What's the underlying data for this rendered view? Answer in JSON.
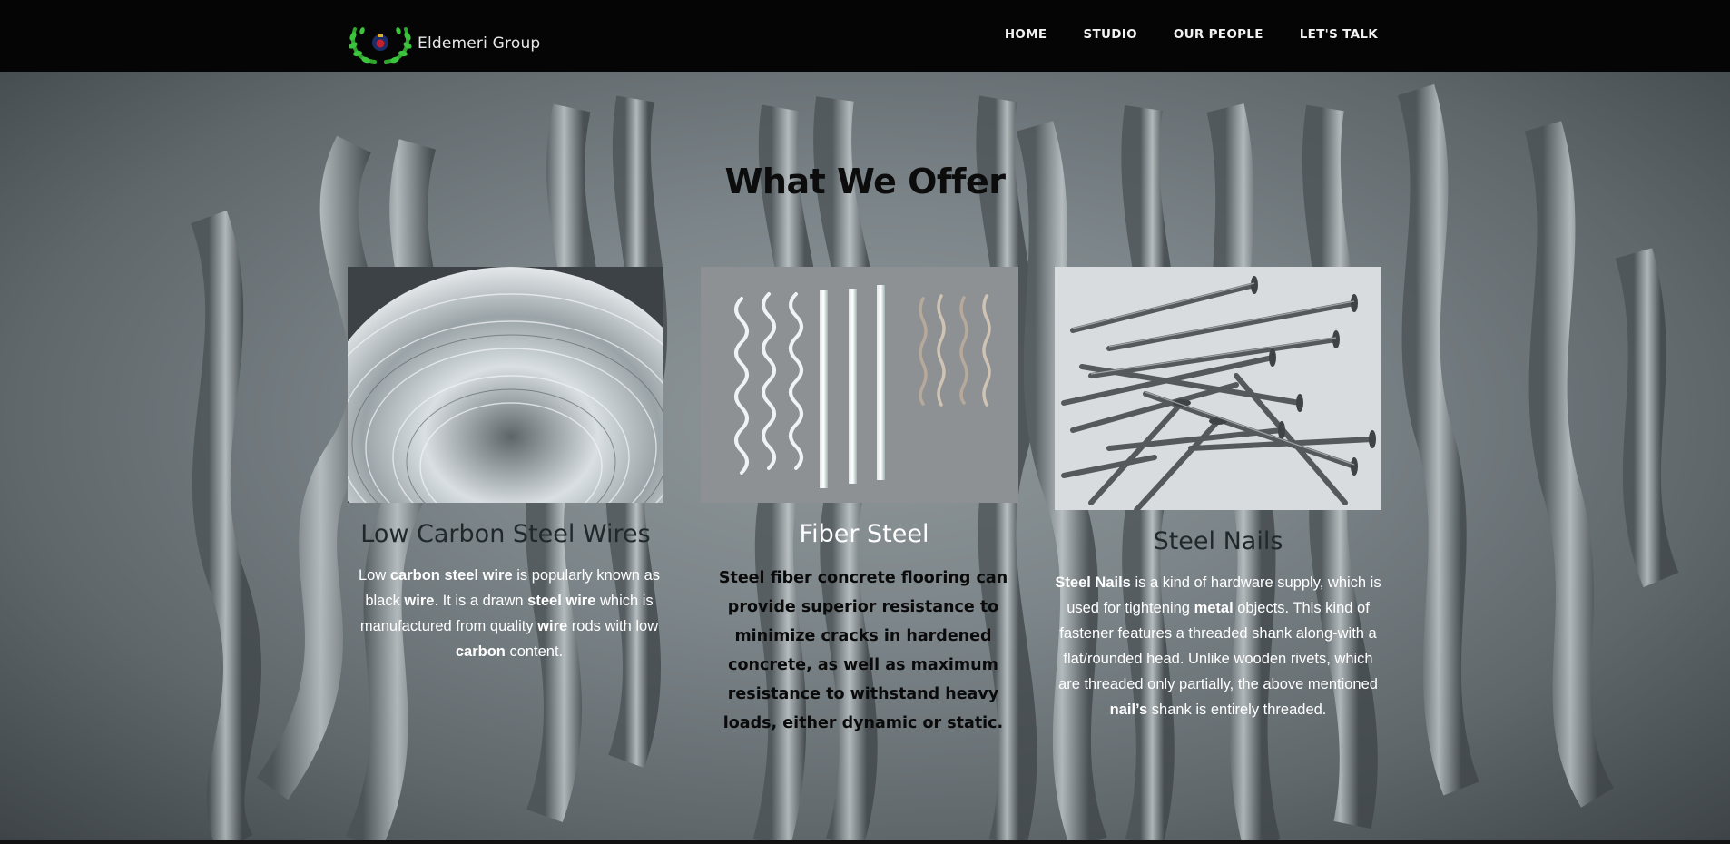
{
  "header": {
    "brand": "Eldemeri Group",
    "nav": [
      "HOME",
      "STUDIO",
      "OUR PEOPLE",
      "LET'S TALK"
    ]
  },
  "main": {
    "heading": "What We Offer",
    "cards": [
      {
        "title": "Low Carbon Steel Wires",
        "image": "steel-wire-coil",
        "text": [
          "Low ",
          "carbon steel wire",
          " is popularly known as black ",
          "wire",
          ". It is a drawn ",
          "steel wire",
          " which is manufactured from quality ",
          "wire",
          " rods with low ",
          "carbon",
          " content."
        ]
      },
      {
        "title": "Fiber Steel",
        "image": "steel-fibers",
        "text": [
          "Steel fiber concrete flooring can provide superior resistance to minimize cracks in hardened concrete, as well as maximum resistance to withstand heavy loads, either dynamic or static."
        ]
      },
      {
        "title": "Steel Nails",
        "image": "steel-nails",
        "text": [
          "Steel Nails",
          " is a kind of hardware supply, which is used for tightening ",
          "metal",
          " objects. This kind of fastener features a threaded shank along-with a flat/rounded head. Unlike wooden rivets, which are threaded only partially, the above mentioned ",
          "nail’s",
          " shank is entirely threaded."
        ]
      }
    ]
  },
  "colors": {
    "header_bg": "#050505",
    "heading": "#0c0c0c",
    "logo_green": "#2fa52f"
  }
}
